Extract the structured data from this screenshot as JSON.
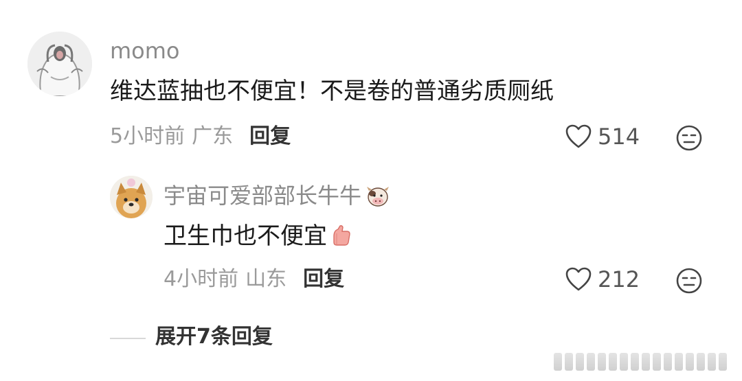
{
  "comment": {
    "username": "momo",
    "text": "维达蓝抽也不便宜！不是卷的普通劣质厕纸",
    "time": "5小时前",
    "location": "广东",
    "reply_label": "回复",
    "likes": "514"
  },
  "reply": {
    "username": "宇宙可爱部部长牛牛",
    "username_badge": "cow-emoji",
    "text": "卫生巾也不便宜",
    "text_emoji": "thumbs-up-emoji",
    "time": "4小时前",
    "location": "山东",
    "reply_label": "回复",
    "likes": "212"
  },
  "expand": {
    "label": "展开7条回复"
  },
  "icons": {
    "like": "heart-icon",
    "dislike": "meh-face-icon"
  },
  "colors": {
    "username": "#8a8a8a",
    "text": "#1a1a1a",
    "meta": "#9a9a9a",
    "action": "#333333",
    "icon": "#444444"
  }
}
